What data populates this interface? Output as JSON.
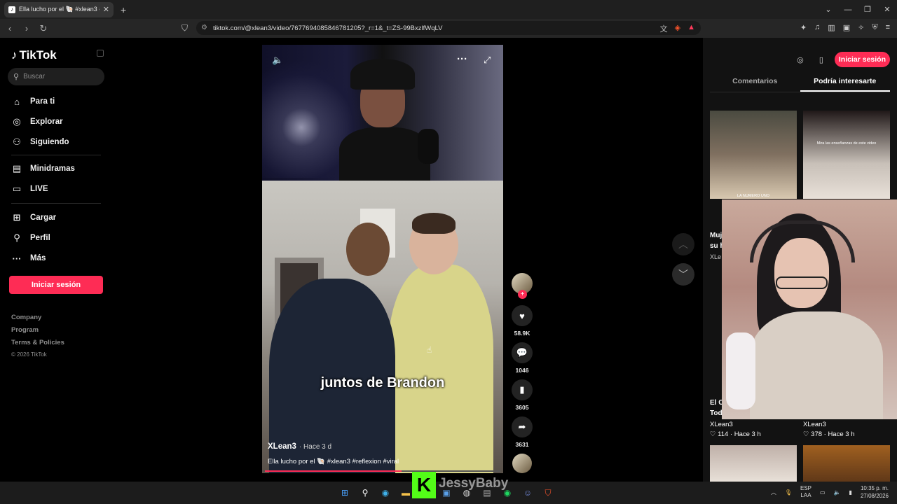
{
  "browser": {
    "tab_title": "Ella lucho por el 🐚 #xlean3 #...",
    "tab_close": "✕",
    "new_tab": "+",
    "url": "tiktok.com/@xlean3/video/7677694085846781205?_r=1&_t=ZS-99BxzlfWqLV",
    "window_controls": [
      "⌄",
      "—",
      "❐",
      "✕"
    ]
  },
  "sidebar": {
    "logo": "TikTok",
    "search_placeholder": "Buscar",
    "items": [
      {
        "label": "Para ti",
        "icon": "⌂"
      },
      {
        "label": "Explorar",
        "icon": "◎"
      },
      {
        "label": "Siguiendo",
        "icon": "⚇"
      },
      {
        "label": "Minidramas",
        "icon": "▤"
      },
      {
        "label": "LIVE",
        "icon": "▭"
      },
      {
        "label": "Cargar",
        "icon": "⊞"
      },
      {
        "label": "Perfil",
        "icon": "⚲"
      },
      {
        "label": "Más",
        "icon": "···"
      }
    ],
    "login": "Iniciar sesión",
    "footer": [
      "Company",
      "Program",
      "Terms & Policies"
    ],
    "copyright": "© 2026 TikTok"
  },
  "video": {
    "caption": "juntos de Brandon",
    "author": "XLean3",
    "time": "· Hace 3 d",
    "description": "Ella lucho por el 🐚 #xlean3 #reflexion #viral",
    "progress": 0.58
  },
  "actions": {
    "likes": "58.9K",
    "comments": "1046",
    "saves": "3605",
    "shares": "3631"
  },
  "right_panel": {
    "login": "Iniciar sesión",
    "tabs": [
      "Comentarios",
      "Podría interesarte"
    ],
    "active_tab": 1,
    "thumb1_text": "LA NUMERO UNO",
    "thumb2_text": "Mira las enseñanzas de este video",
    "partial_title1": "Muj",
    "partial_title1b": "su h",
    "partial_user1": "XLe",
    "partial_title2": "El C",
    "partial_title2b": "Tod",
    "cards": [
      {
        "user": "XLean3",
        "stats": "♡ 114 · Hace 3 h"
      },
      {
        "user": "XLean3",
        "stats": "♡ 378 · Hace 3 h"
      }
    ]
  },
  "overlay": {
    "kick_logo": "K",
    "streamer": "JessyBaby"
  },
  "taskbar": {
    "lang_top": "ESP",
    "lang_bottom": "LAA",
    "time": "10:35 p. m.",
    "date": "27/08/2026"
  }
}
